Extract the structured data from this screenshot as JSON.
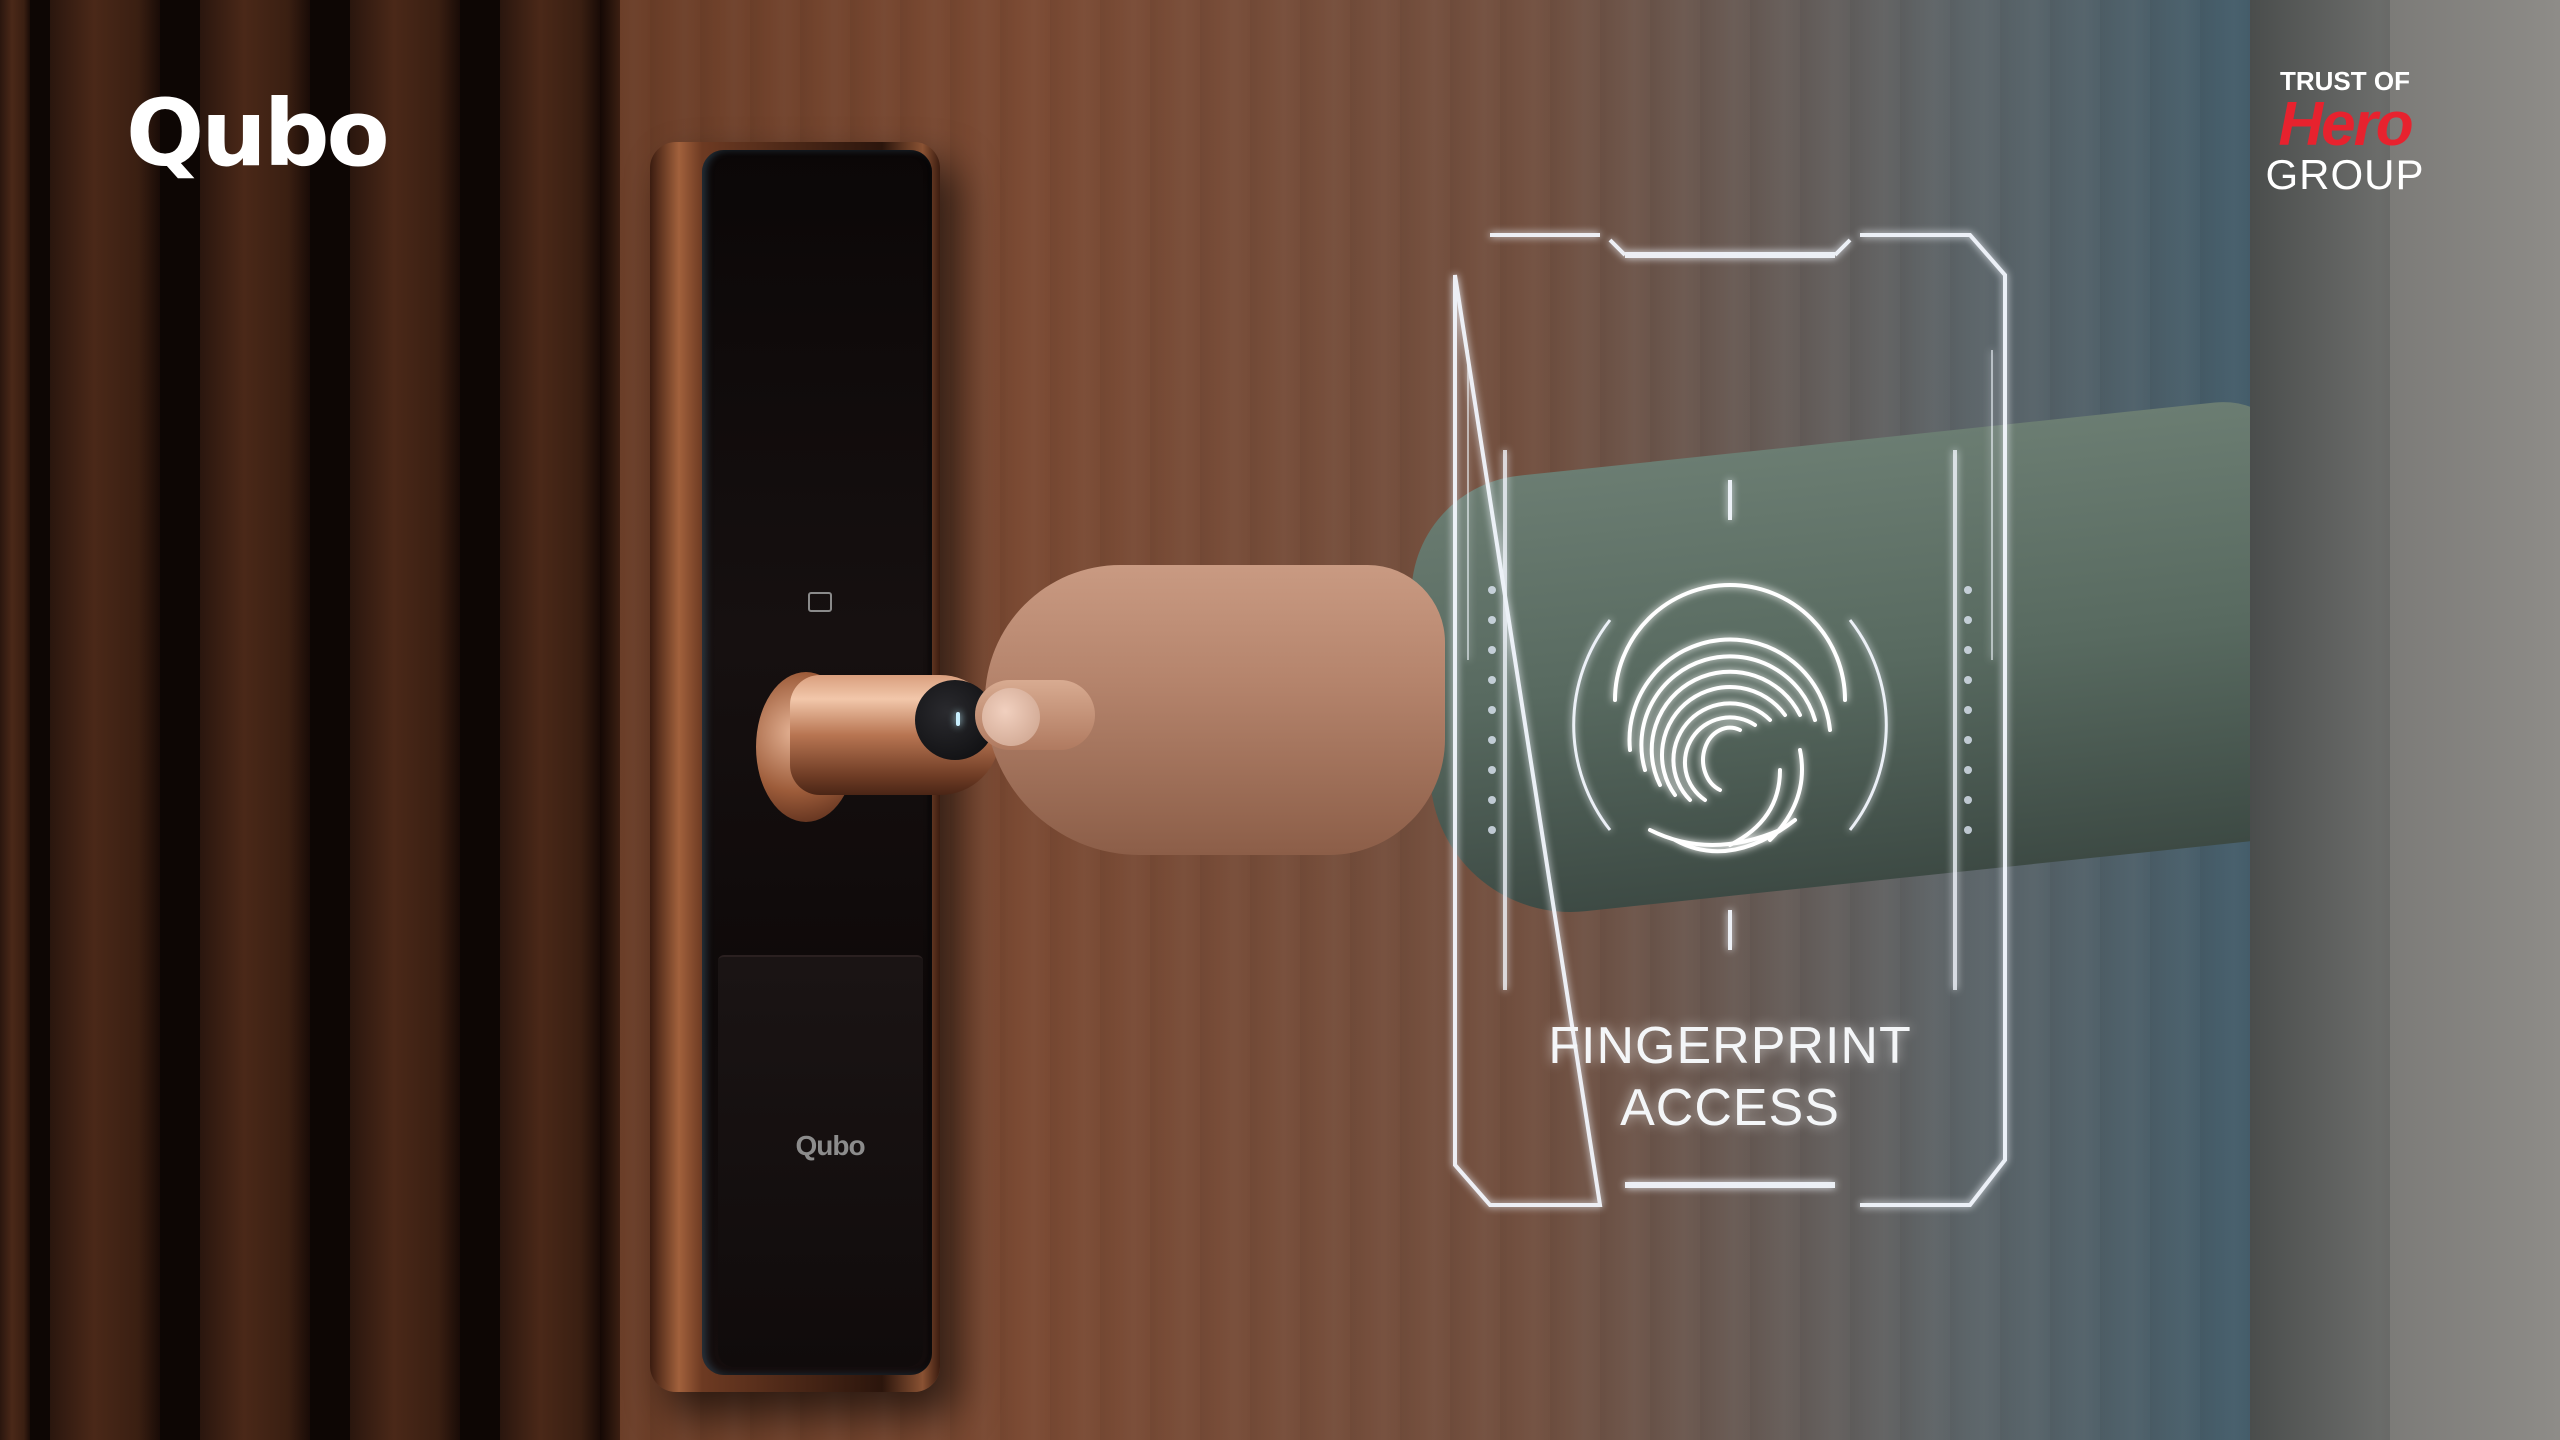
{
  "brand": {
    "logo": "Qubo",
    "lock_logo": "Qubo"
  },
  "partner": {
    "trust_line": "TRUST OF",
    "hero_word": "Hero",
    "group_word": "GROUP",
    "hero_color": "#e7222e"
  },
  "feature": {
    "line1": "FINGERPRINT",
    "line2": "ACCESS",
    "icon": "fingerprint-icon"
  }
}
